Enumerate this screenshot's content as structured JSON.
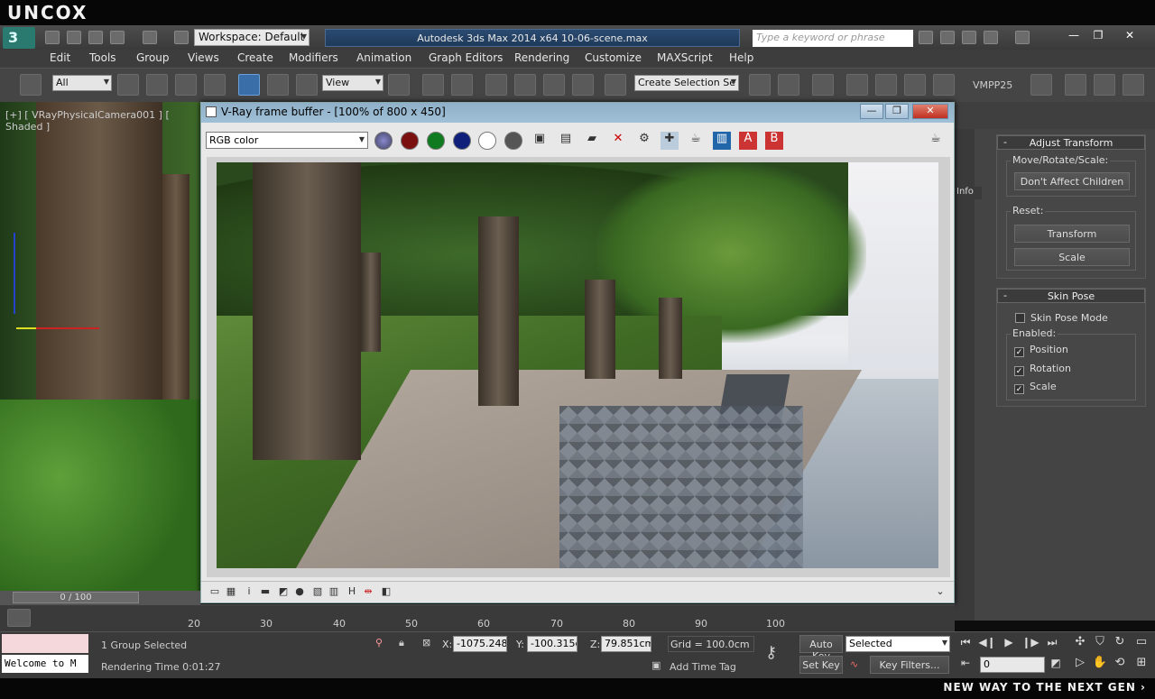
{
  "watermark": {
    "logo": "UNCOX",
    "slogan": "NEW WAY TO THE NEXT GEN ›"
  },
  "titlebar": {
    "app_logo_glyph": "3",
    "workspace": "Workspace: Default",
    "document_title": "Autodesk 3ds Max  2014 x64      10-06-scene.max",
    "search_placeholder": "Type a keyword or phrase",
    "window_buttons": [
      "—",
      "❐",
      "✕"
    ]
  },
  "menu": [
    "Edit",
    "Tools",
    "Group",
    "Views",
    "Create",
    "Modifiers",
    "Animation",
    "Graph Editors",
    "Rendering",
    "Customize",
    "MAXScript",
    "Help"
  ],
  "toolbar": {
    "selection_filter": "All",
    "ref_coord": "View",
    "named_selection": "Create Selection Se",
    "plugin_label": "VMPP25"
  },
  "viewport": {
    "label": "[+] [ VRayPhysicalCamera001 ] [ Shaded ]"
  },
  "vfb": {
    "title": "V-Ray frame buffer - [100% of 800 x 450]",
    "channel": "RGB color",
    "controls": [
      "—",
      "❐",
      "✕"
    ],
    "channel_colors": [
      "#7a1010",
      "#107a20",
      "#10207a",
      "#ffffff",
      "#555555"
    ]
  },
  "command_panel": {
    "info_label": "Info",
    "adjust_transform": {
      "header": "Adjust Transform",
      "move_group_label": "Move/Rotate/Scale:",
      "dont_affect_children": "Don't Affect Children",
      "reset_group_label": "Reset:",
      "transform_button": "Transform",
      "scale_button": "Scale"
    },
    "skin_pose": {
      "header": "Skin Pose",
      "skin_pose_mode": "Skin Pose Mode",
      "enabled_label": "Enabled:",
      "position": "Position",
      "rotation": "Rotation",
      "scale": "Scale"
    }
  },
  "timeline": {
    "slider_label": "0 / 100",
    "ticks": [
      "20",
      "30",
      "40",
      "50",
      "60",
      "70",
      "80",
      "90",
      "100"
    ]
  },
  "status": {
    "listener_text": "Welcome to M",
    "selection_text": "1 Group Selected",
    "render_time": "Rendering Time  0:01:27",
    "x_label": "X:",
    "x_value": "-1075.248",
    "y_label": "Y:",
    "y_value": "-100.315cr",
    "z_label": "Z:",
    "z_value": "79.851cm",
    "grid": "Grid = 100.0cm",
    "add_time_tag": "Add Time Tag",
    "auto_key": "Auto Key",
    "selected_option": "Selected",
    "set_key": "Set Key",
    "key_filters": "Key Filters...",
    "current_frame": "0"
  }
}
